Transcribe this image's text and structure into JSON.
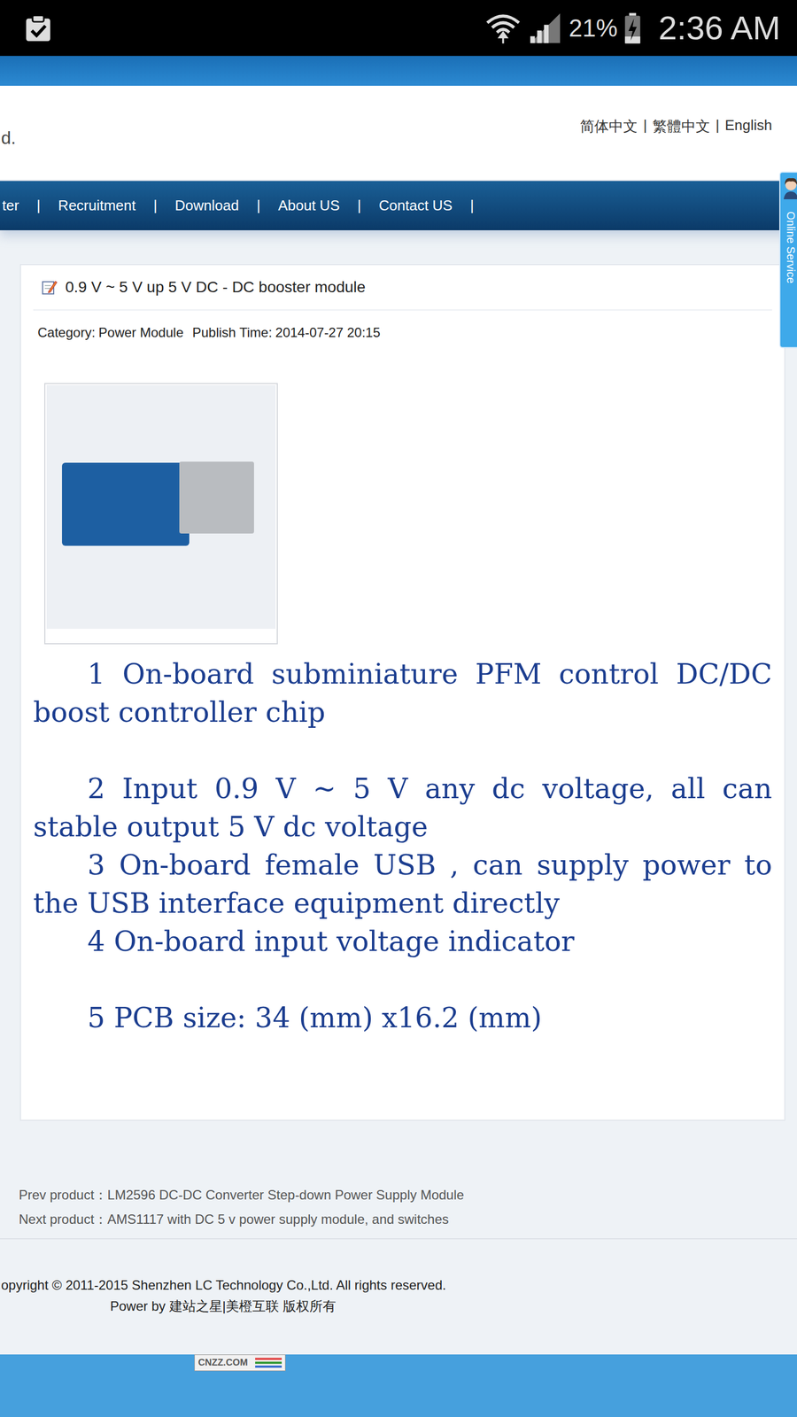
{
  "status_bar": {
    "battery": "21%",
    "time": "2:36 AM"
  },
  "header": {
    "logo_text": "d.",
    "languages": [
      "简体中文",
      "繁體中文",
      "English"
    ],
    "language_separator": "|"
  },
  "nav": {
    "separator": "|",
    "items": [
      "ter",
      "Recruitment",
      "Download",
      "About US",
      "Contact US"
    ]
  },
  "online_service": {
    "label": "Online Service"
  },
  "article": {
    "title": "0.9 V ~ 5 V up 5 V DC - DC booster module",
    "category_label": "Category:",
    "category": "Power Module",
    "publish_label": "Publish Time:",
    "publish_time": "2014-07-27 20:15",
    "features": [
      "1 On-board subminiature PFM control DC/DC boost controller chip",
      "2 Input 0.9 V ~ 5 V any dc voltage, all can stable output 5 V dc voltage",
      "3 On-board female USB , can supply power to the USB interface equipment directly",
      "4 On-board input voltage indicator",
      "5 PCB size: 34 (mm) x16.2 (mm)"
    ]
  },
  "pager": [
    {
      "label": "Prev product：",
      "value": "LM2596 DC-DC Converter Step-down Power Supply Module"
    },
    {
      "label": "Next product：",
      "value": "AMS1117 with DC 5 v power supply module, and switches"
    }
  ],
  "footer": {
    "copyright": "opyright © 2011-2015 Shenzhen LC Technology Co.,Ltd. All rights reserved.",
    "powered": "Power by 建站之星|美橙互联 版权所有",
    "badge": "CNZZ.COM"
  }
}
